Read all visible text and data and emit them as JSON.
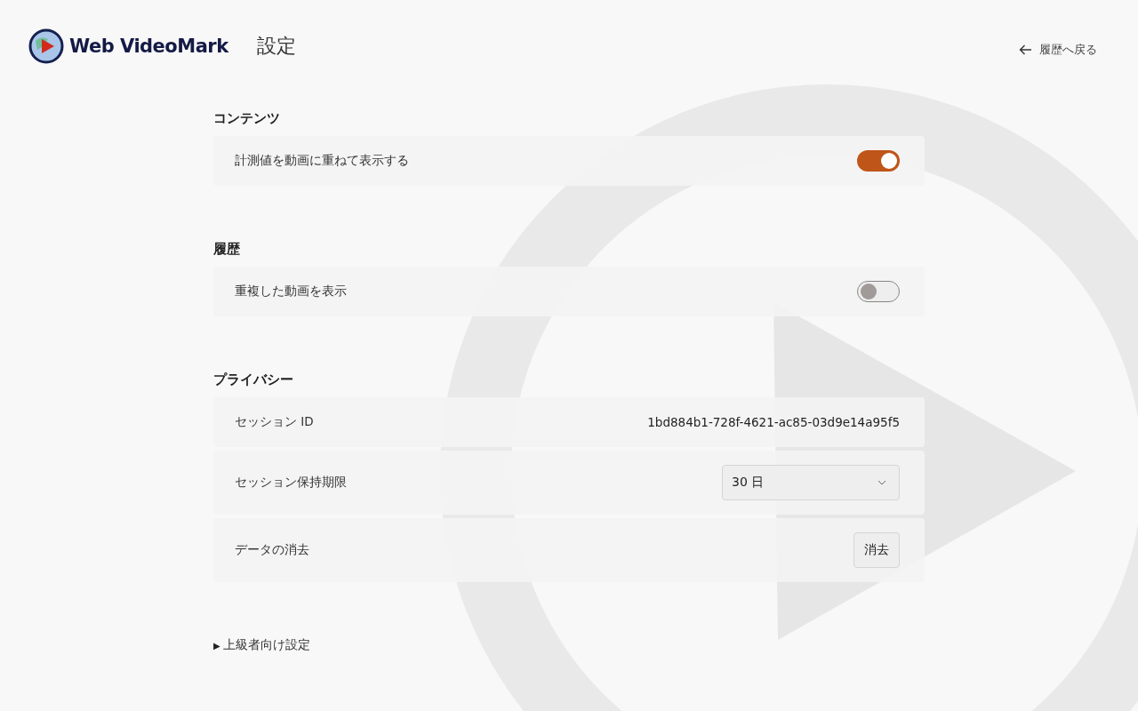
{
  "header": {
    "brand": "Web VideoMark",
    "title": "設定",
    "back_link": "履歴へ戻る"
  },
  "sections": [
    {
      "heading": "コンテンツ",
      "rows": [
        {
          "kind": "toggle",
          "label": "計測値を動画に重ねて表示する",
          "on": true
        }
      ]
    },
    {
      "heading": "履歴",
      "rows": [
        {
          "kind": "toggle",
          "label": "重複した動画を表示",
          "on": false
        }
      ]
    },
    {
      "heading": "プライバシー",
      "rows": [
        {
          "kind": "text",
          "label": "セッション ID",
          "value": "1bd884b1-728f-4621-ac85-03d9e14a95f5"
        },
        {
          "kind": "select",
          "label": "セッション保持期限",
          "value": "30 日"
        },
        {
          "kind": "button",
          "label": "データの消去",
          "button": "消去"
        }
      ]
    }
  ],
  "advanced": {
    "marker": "▶",
    "label": "上級者向け設定",
    "expanded": false
  }
}
